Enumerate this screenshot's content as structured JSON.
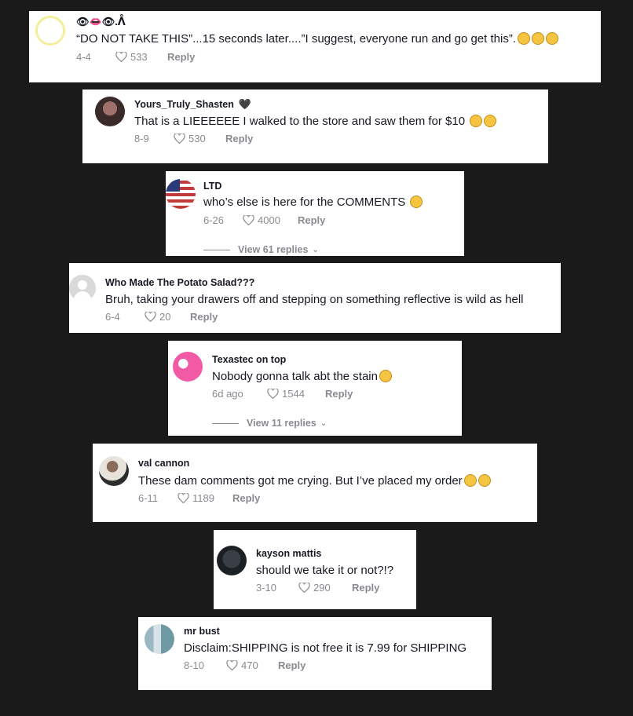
{
  "comments": [
    {
      "username": "👁👄👁.ᐰ",
      "text": "“DO NOT TAKE THIS”...15 seconds later....”I suggest, everyone run and go get this”.",
      "date": "4-4",
      "likes": "533",
      "reply_label": "Reply",
      "emoji_count": 3,
      "avatar_icon": "ring-avatar-icon"
    },
    {
      "username": "Yours_Truly_Shasten",
      "username_suffix": "🖤",
      "text": "That is a LIEEEEEE I walked to the store and saw them for $10",
      "date": "8-9",
      "likes": "530",
      "reply_label": "Reply",
      "emoji_count": 2,
      "avatar_icon": "user-photo-avatar"
    },
    {
      "username": "LTD",
      "text": "who’s else is here for the COMMENTS",
      "date": "6-26",
      "likes": "4000",
      "reply_label": "Reply",
      "emoji_count": 1,
      "view_replies": "View 61 replies",
      "avatar_icon": "flag-avatar"
    },
    {
      "username": "Who Made The Potato Salad???",
      "text": "Bruh, taking your drawers off and stepping on something reflective is wild as hell",
      "date": "6-4",
      "likes": "20",
      "reply_label": "Reply",
      "emoji_count": 0,
      "avatar_icon": "default-user-avatar-icon"
    },
    {
      "username": "Texastec on top",
      "text": "Nobody gonna talk abt the stain",
      "date": "6d ago",
      "likes": "1544",
      "reply_label": "Reply",
      "emoji_count": 1,
      "view_replies": "View 11 replies",
      "avatar_icon": "pink-avatar"
    },
    {
      "username": "val cannon",
      "text": "These dam comments got me crying. But I’ve placed my order",
      "date": "6-11",
      "likes": "1189",
      "reply_label": "Reply",
      "emoji_count": 2,
      "avatar_icon": "user-photo-avatar"
    },
    {
      "username": "kayson mattis",
      "text": "should we take it or not?!?",
      "date": "3-10",
      "likes": "290",
      "reply_label": "Reply",
      "emoji_count": 0,
      "avatar_icon": "dark-avatar"
    },
    {
      "username": "mr bust",
      "text": "Disclaim:SHIPPING is not free it is 7.99 for SHIPPING",
      "date": "8-10",
      "likes": "470",
      "reply_label": "Reply",
      "emoji_count": 0,
      "avatar_icon": "user-photo-avatar"
    }
  ],
  "colors": {
    "background": "#1a1a1a",
    "card": "#ffffff",
    "text": "#161823",
    "meta": "#8a8b91",
    "emoji": "#f5c542"
  }
}
